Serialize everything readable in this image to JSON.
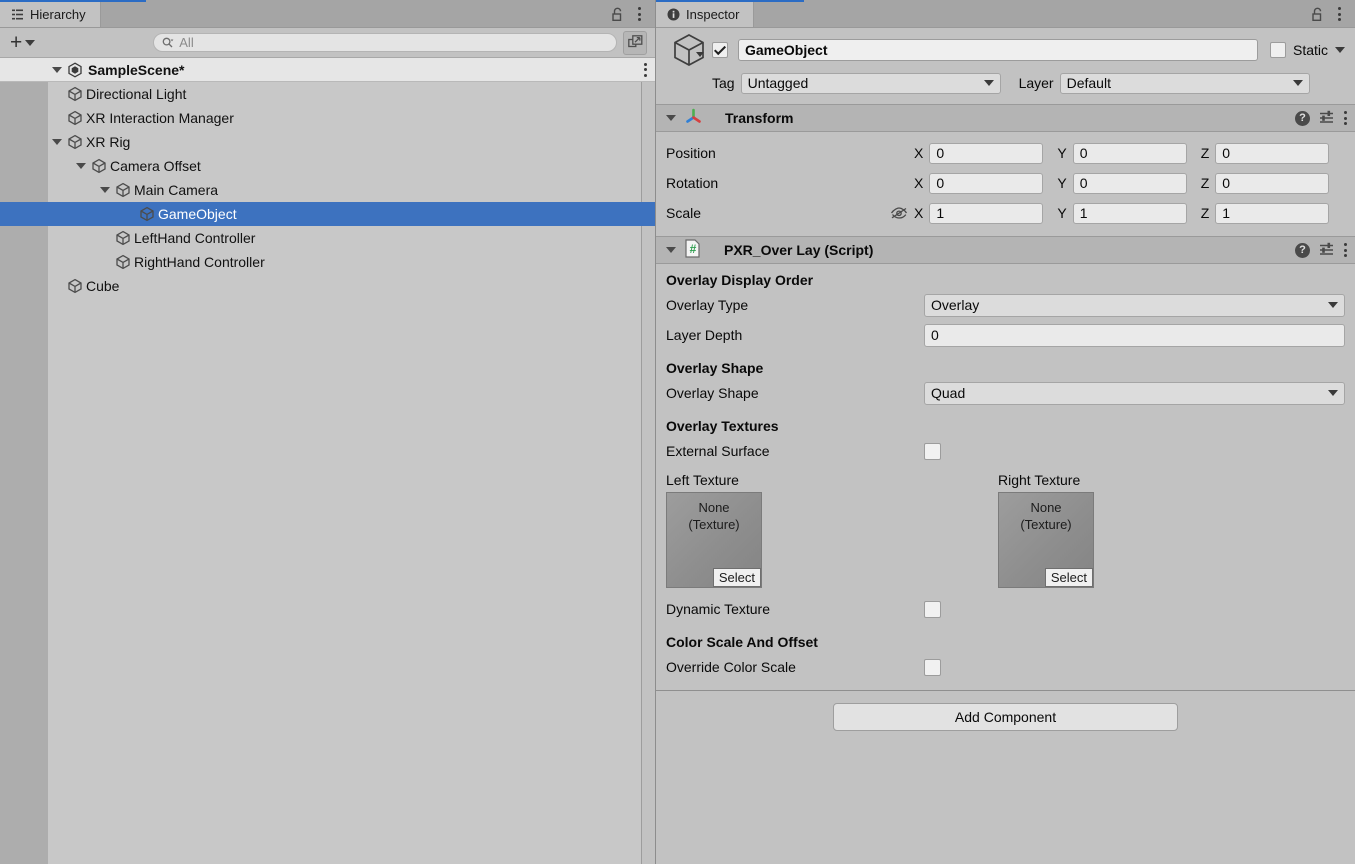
{
  "hierarchy": {
    "tab_label": "Hierarchy",
    "tab_icon": "hierarchy-icon",
    "lock_icon": "lock-open-icon",
    "menu_icon": "kebab-menu-icon",
    "add_label": "+",
    "search": {
      "placeholder": "All",
      "icon": "search-icon"
    },
    "popout_icon": "open-in-new-window-icon",
    "scene": {
      "label": "SampleScene*",
      "icon": "unity-scene-icon",
      "expanded": true
    },
    "items": [
      {
        "label": "Directional Light",
        "depth": 1,
        "expanded": null,
        "selected": false
      },
      {
        "label": "XR Interaction Manager",
        "depth": 1,
        "expanded": null,
        "selected": false
      },
      {
        "label": "XR Rig",
        "depth": 1,
        "expanded": true,
        "selected": false
      },
      {
        "label": "Camera Offset",
        "depth": 2,
        "expanded": true,
        "selected": false
      },
      {
        "label": "Main Camera",
        "depth": 3,
        "expanded": true,
        "selected": false
      },
      {
        "label": "GameObject",
        "depth": 4,
        "expanded": null,
        "selected": true
      },
      {
        "label": "LeftHand Controller",
        "depth": 3,
        "expanded": null,
        "selected": false
      },
      {
        "label": "RightHand Controller",
        "depth": 3,
        "expanded": null,
        "selected": false
      },
      {
        "label": "Cube",
        "depth": 1,
        "expanded": null,
        "selected": false
      }
    ]
  },
  "inspector": {
    "tab_label": "Inspector",
    "tab_icon": "info-icon",
    "lock_icon": "lock-open-icon",
    "menu_icon": "kebab-menu-icon",
    "object": {
      "icon": "gameobject-cube-icon",
      "enabled": true,
      "name": "GameObject",
      "static_label": "Static",
      "static_checked": false,
      "tag_label": "Tag",
      "tag_value": "Untagged",
      "layer_label": "Layer",
      "layer_value": "Default"
    },
    "transform": {
      "title": "Transform",
      "icon": "transform-axis-icon",
      "expanded": true,
      "help_icon": "help-icon",
      "preset_icon": "preset-sliders-icon",
      "menu_icon": "kebab-menu-icon",
      "rows": [
        {
          "label": "Position",
          "x": "0",
          "y": "0",
          "z": "0",
          "has_eye": false
        },
        {
          "label": "Rotation",
          "x": "0",
          "y": "0",
          "z": "0",
          "has_eye": false
        },
        {
          "label": "Scale",
          "x": "1",
          "y": "1",
          "z": "1",
          "has_eye": true
        }
      ],
      "axis_x": "X",
      "axis_y": "Y",
      "axis_z": "Z",
      "eye_icon": "eye-slash-icon"
    },
    "script_component": {
      "title": "PXR_Over Lay (Script)",
      "icon": "cs-script-icon",
      "expanded": true,
      "help_icon": "help-icon",
      "preset_icon": "preset-sliders-icon",
      "menu_icon": "kebab-menu-icon",
      "sections": {
        "display_order": {
          "heading": "Overlay Display Order",
          "overlay_type_label": "Overlay Type",
          "overlay_type_value": "Overlay",
          "layer_depth_label": "Layer Depth",
          "layer_depth_value": "0"
        },
        "shape": {
          "heading": "Overlay Shape",
          "shape_label": "Overlay Shape",
          "shape_value": "Quad"
        },
        "textures": {
          "heading": "Overlay Textures",
          "external_surface_label": "External Surface",
          "external_surface_checked": false,
          "left_label": "Left Texture",
          "right_label": "Right Texture",
          "none_line1": "None",
          "none_line2": "(Texture)",
          "select_label": "Select",
          "dynamic_texture_label": "Dynamic Texture",
          "dynamic_texture_checked": false
        },
        "color_scale": {
          "heading": "Color Scale And Offset",
          "override_label": "Override Color Scale",
          "override_checked": false
        }
      }
    },
    "add_component_label": "Add Component"
  },
  "colors": {
    "selection_blue": "#3d72bf",
    "tab_accent": "#2b6cc4",
    "panel_bg": "#c2c2c2",
    "tree_bg": "#c8c8c8",
    "gutter": "#adadad",
    "component_header": "#b4b4b4"
  }
}
